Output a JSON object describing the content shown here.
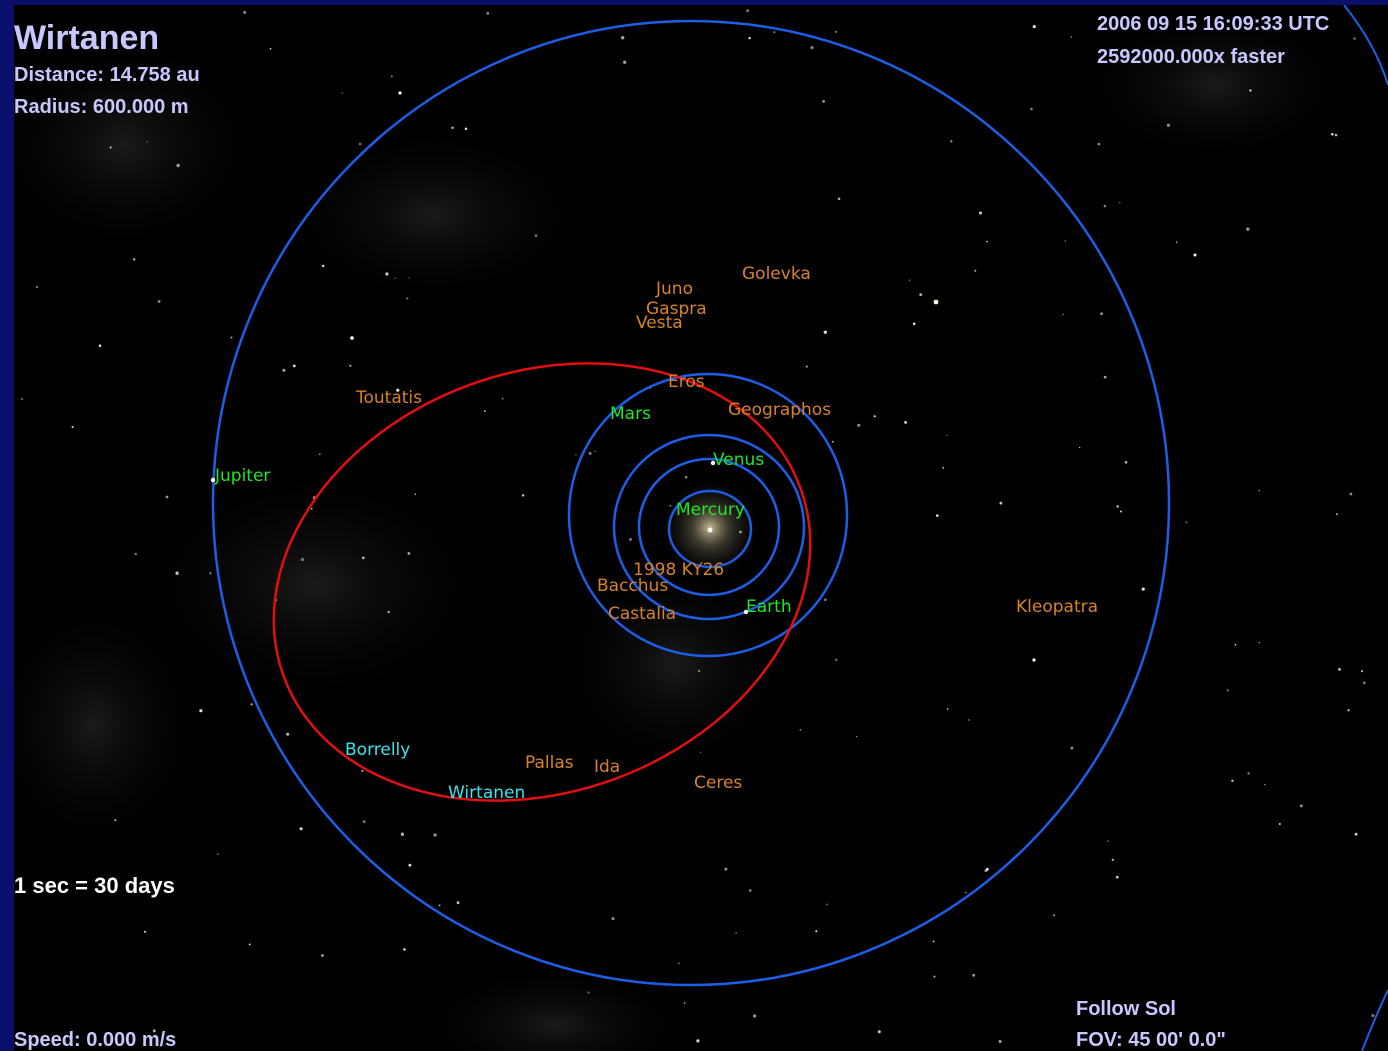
{
  "window": {
    "frame_color": "#0a0f6b",
    "background": "#000000"
  },
  "selection": {
    "name": "Wirtanen",
    "distance": "Distance: 14.758 au",
    "radius": "Radius: 600.000 m"
  },
  "time": {
    "datetime": "2006 09 15 16:09:33 UTC",
    "rate": "2592000.000x faster"
  },
  "time_scale": "1 sec = 30 days",
  "speed": "Speed: 0.000 m/s",
  "follow": "Follow Sol",
  "fov": "FOV: 45 00' 0.0\"",
  "colors": {
    "hud_text": "#c8c8ff",
    "planet_label": "#22e622",
    "asteroid_label": "#d8822a",
    "comet_label": "#38e6f0",
    "planet_orbit": "#1e5ee6",
    "selected_orbit": "#e01010"
  },
  "labels": {
    "planets": {
      "mercury": "Mercury",
      "venus": "Venus",
      "earth": "Earth",
      "mars": "Mars",
      "jupiter": "Jupiter"
    },
    "asteroids": {
      "juno": "Juno",
      "gaspra": "Gaspra",
      "vesta": "Vesta",
      "golevka": "Golevka",
      "eros": "Eros",
      "geographos": "Geographos",
      "toutatis": "Toutatis",
      "ky26": "1998 KY26",
      "bacchus": "Bacchus",
      "castalia": "Castalia",
      "kleopatra": "Kleopatra",
      "pallas": "Pallas",
      "ida": "Ida",
      "ceres": "Ceres"
    },
    "comets": {
      "borrelly": "Borrelly",
      "wirtanen": "Wirtanen"
    }
  }
}
